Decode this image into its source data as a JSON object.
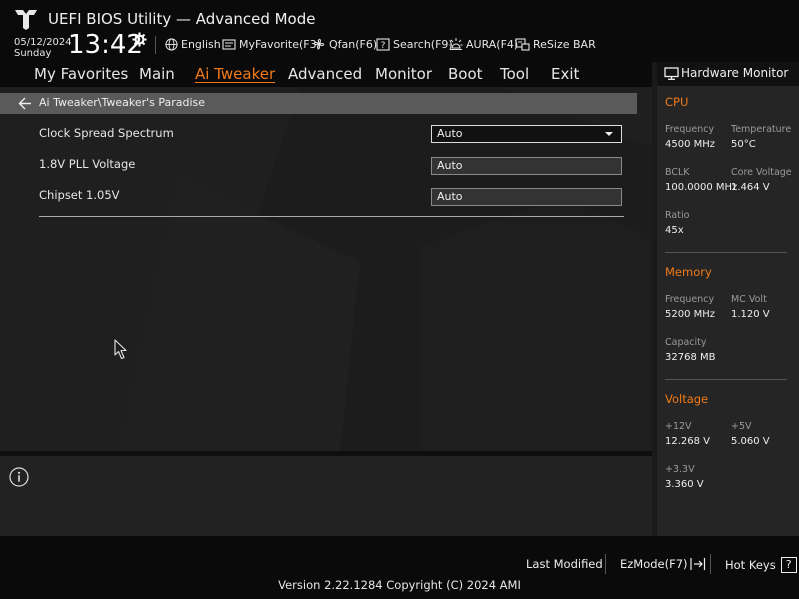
{
  "header": {
    "title": "UEFI BIOS Utility — Advanced Mode",
    "date": "05/12/2024",
    "day": "Sunday",
    "time": "13:42",
    "toolbar": {
      "language": "English",
      "myfavorite": "MyFavorite(F3)",
      "qfan": "Qfan(F6)",
      "search": "Search(F9)",
      "aura": "AURA(F4)",
      "resize_bar": "ReSize BAR"
    }
  },
  "nav": {
    "tabs": [
      {
        "label": "My Favorites"
      },
      {
        "label": "Main"
      },
      {
        "label": "Ai Tweaker"
      },
      {
        "label": "Advanced"
      },
      {
        "label": "Monitor"
      },
      {
        "label": "Boot"
      },
      {
        "label": "Tool"
      },
      {
        "label": "Exit"
      }
    ],
    "active_tab": "Ai Tweaker"
  },
  "breadcrumb": "Ai Tweaker\\Tweaker's Paradise",
  "settings": [
    {
      "label": "Clock Spread Spectrum",
      "value": "Auto",
      "control": "dropdown"
    },
    {
      "label": "1.8V PLL Voltage",
      "value": "Auto",
      "control": "textbox"
    },
    {
      "label": "Chipset 1.05V",
      "value": "Auto",
      "control": "textbox"
    }
  ],
  "hardware_monitor": {
    "title": "Hardware Monitor",
    "cpu": {
      "section": "CPU",
      "frequency_label": "Frequency",
      "frequency": "4500 MHz",
      "temperature_label": "Temperature",
      "temperature": "50°C",
      "bclk_label": "BCLK",
      "bclk": "100.0000 MHz",
      "core_voltage_label": "Core Voltage",
      "core_voltage": "1.464 V",
      "ratio_label": "Ratio",
      "ratio": "45x"
    },
    "memory": {
      "section": "Memory",
      "frequency_label": "Frequency",
      "frequency": "5200 MHz",
      "mc_volt_label": "MC Volt",
      "mc_volt": "1.120 V",
      "capacity_label": "Capacity",
      "capacity": "32768 MB"
    },
    "voltage": {
      "section": "Voltage",
      "v12_label": "+12V",
      "v12": "12.268 V",
      "v5_label": "+5V",
      "v5": "5.060 V",
      "v33_label": "+3.3V",
      "v33": "3.360 V"
    }
  },
  "footer": {
    "last_modified": "Last Modified",
    "ezmode": "EzMode(F7)",
    "hotkeys": "Hot Keys",
    "hotkeys_glyph": "?",
    "version": "Version 2.22.1284 Copyright (C) 2024 AMI"
  },
  "colors": {
    "accent": "#f07a18",
    "background": "#1c1c1c",
    "bar": "#0a0a0a"
  }
}
